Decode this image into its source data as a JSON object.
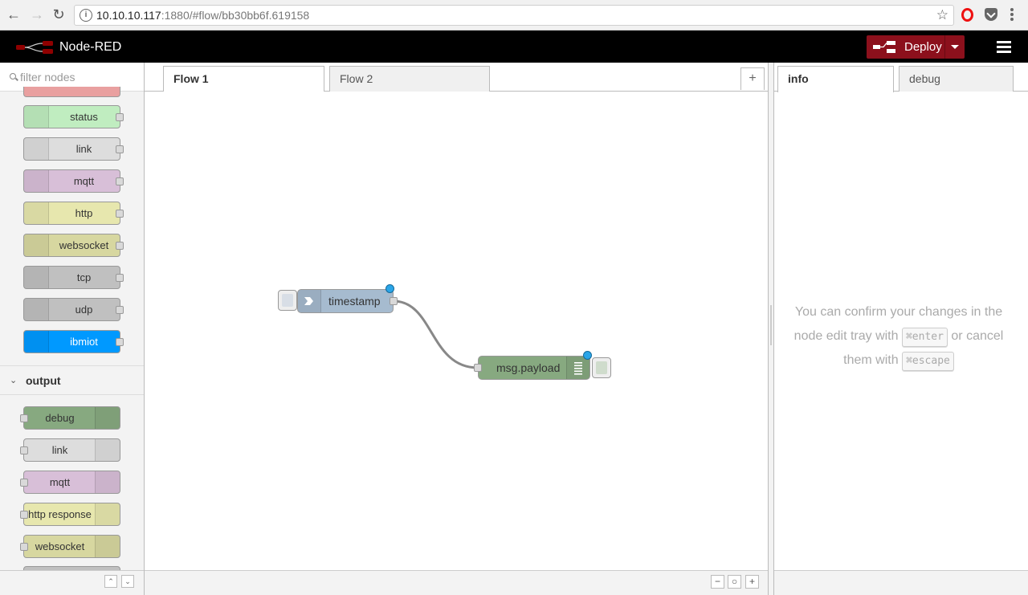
{
  "browser": {
    "url_host": "10.10.10.117",
    "url_rest": ":1880/#flow/bb30bb6f.619158"
  },
  "header": {
    "title": "Node-RED",
    "deploy_label": "Deploy"
  },
  "palette": {
    "filter_placeholder": "filter nodes",
    "input_nodes": [
      {
        "label": "status",
        "color": "#c0edc0"
      },
      {
        "label": "link",
        "color": "#dddddd"
      },
      {
        "label": "mqtt",
        "color": "#d8bfd8"
      },
      {
        "label": "http",
        "color": "#e7e7ae"
      },
      {
        "label": "websocket",
        "color": "#d7d7a0"
      },
      {
        "label": "tcp",
        "color": "#c0c0c0"
      },
      {
        "label": "udp",
        "color": "#c0c0c0"
      },
      {
        "label": "ibmiot",
        "color": "#0099ff"
      }
    ],
    "output_category": "output",
    "output_nodes": [
      {
        "label": "debug",
        "color": "#87a980"
      },
      {
        "label": "link",
        "color": "#dddddd"
      },
      {
        "label": "mqtt",
        "color": "#d8bfd8"
      },
      {
        "label": "http response",
        "color": "#e7e7ae"
      },
      {
        "label": "websocket",
        "color": "#d7d7a0"
      }
    ]
  },
  "workspace": {
    "tabs": [
      {
        "label": "Flow 1",
        "active": true
      },
      {
        "label": "Flow 2",
        "active": false
      }
    ],
    "nodes": {
      "inject": {
        "label": "timestamp",
        "color": "#a6bbcf"
      },
      "debug": {
        "label": "msg.payload",
        "color": "#87a980"
      }
    }
  },
  "sidebar": {
    "tabs": [
      {
        "label": "info",
        "active": true
      },
      {
        "label": "debug",
        "active": false
      }
    ],
    "message_part1": "You can confirm your changes in the node edit tray with",
    "key_enter": "⌘enter",
    "message_part2": "or cancel them with",
    "key_escape": "⌘escape"
  }
}
